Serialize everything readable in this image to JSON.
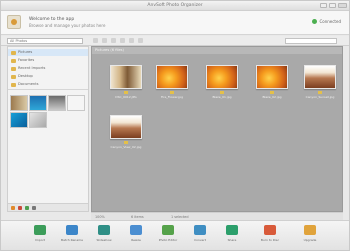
{
  "colors": {
    "accent": "#4caf50",
    "main_bg": "#a9a9a9",
    "folder": "#e1b64d",
    "selection": "#d7e7f7"
  },
  "window": {
    "title": "AnvSoft Photo Organizer"
  },
  "header": {
    "line1": "Welcome to the app",
    "line2": "Browse and manage your photos here",
    "status_label": "Connected"
  },
  "toolbar": {
    "select_value": "All Photos"
  },
  "sidebar": {
    "items": [
      {
        "label": "Pictures",
        "icon": "folder-icon"
      },
      {
        "label": "Favorites",
        "icon": "star-icon"
      },
      {
        "label": "Recent Imports",
        "icon": "folder-icon"
      },
      {
        "label": "Desktop",
        "icon": "folder-icon"
      },
      {
        "label": "Documents",
        "icon": "folder-icon"
      }
    ]
  },
  "main": {
    "title": "Pictures (6 files)",
    "photos": [
      {
        "label": "DSC_0012.JPG",
        "kind": "brown"
      },
      {
        "label": "Fire_Flower.jpg",
        "kind": "fire"
      },
      {
        "label": "Blaze_01.jpg",
        "kind": "fire"
      },
      {
        "label": "Blaze_02.jpg",
        "kind": "fire"
      },
      {
        "label": "Canyon_Sunset.jpg",
        "kind": "canyon"
      },
      {
        "label": "Canyon_View_02.jpg",
        "kind": "canyon"
      }
    ]
  },
  "statusbar": {
    "zoom": "100%",
    "count": "6 items",
    "selected": "1 selected"
  },
  "actions": [
    {
      "label": "Import",
      "icon": "import-icon",
      "color": "#3c9d5a"
    },
    {
      "label": "Batch Rename",
      "icon": "rename-icon",
      "color": "#3c86c9"
    },
    {
      "label": "Slideshow",
      "icon": "slideshow-icon",
      "color": "#2f8f86"
    },
    {
      "label": "Resize",
      "icon": "resize-icon",
      "color": "#4b8ed1"
    },
    {
      "label": "Photo Editor",
      "icon": "editor-icon",
      "color": "#55a24a"
    },
    {
      "label": "Convert",
      "icon": "convert-icon",
      "color": "#3f8ec2"
    },
    {
      "label": "Share",
      "icon": "share-icon",
      "color": "#2c9f6b"
    },
    {
      "label": "Burn to Disc",
      "icon": "disc-icon",
      "color": "#d85a3a"
    },
    {
      "label": "Upgrade",
      "icon": "upgrade-icon",
      "color": "#e0a33b"
    }
  ]
}
